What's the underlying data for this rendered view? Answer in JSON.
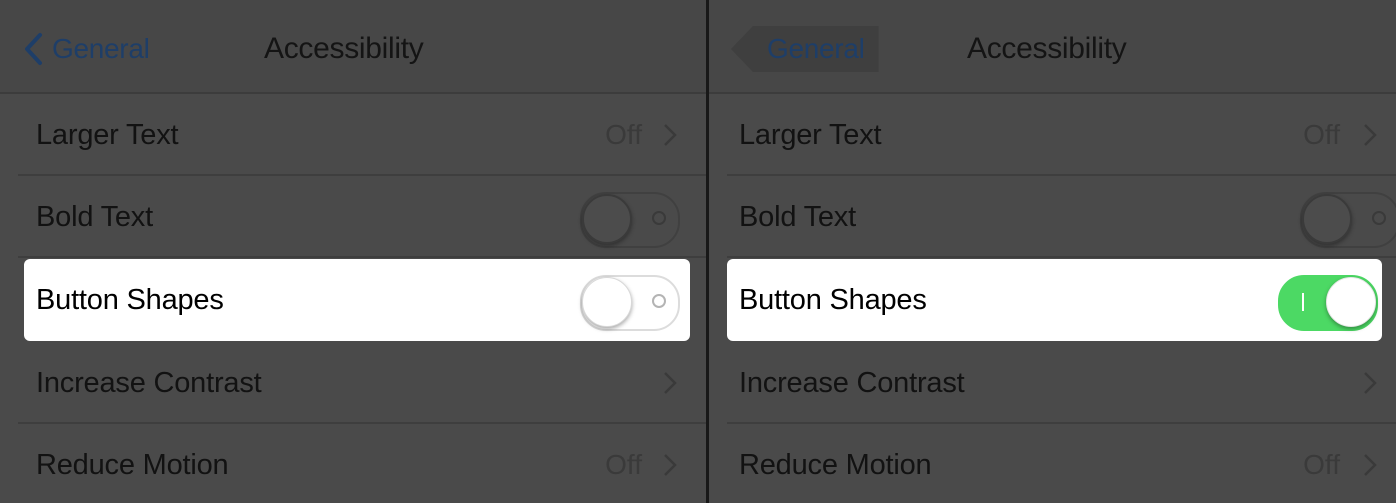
{
  "panels": [
    {
      "nav": {
        "back_label": "General",
        "title": "Accessibility"
      },
      "rows": [
        {
          "label": "Larger Text",
          "value": "Off"
        },
        {
          "label": "Bold Text",
          "toggle": "off"
        },
        {
          "label": "Button Shapes",
          "toggle": "off"
        },
        {
          "label": "Increase Contrast"
        },
        {
          "label": "Reduce Motion",
          "value": "Off"
        }
      ]
    },
    {
      "nav": {
        "back_label": "General",
        "title": "Accessibility"
      },
      "rows": [
        {
          "label": "Larger Text",
          "value": "Off"
        },
        {
          "label": "Bold Text",
          "toggle": "off"
        },
        {
          "label": "Button Shapes",
          "toggle": "on"
        },
        {
          "label": "Increase Contrast"
        },
        {
          "label": "Reduce Motion",
          "value": "Off"
        }
      ]
    }
  ],
  "colors": {
    "accent": "#1e3e68",
    "toggle_on": "#4cd964",
    "overlay": "#4a4a4a",
    "highlight": "#ffffff"
  },
  "icons": {
    "back": "chevron-left-icon",
    "disclosure": "chevron-right-icon"
  }
}
